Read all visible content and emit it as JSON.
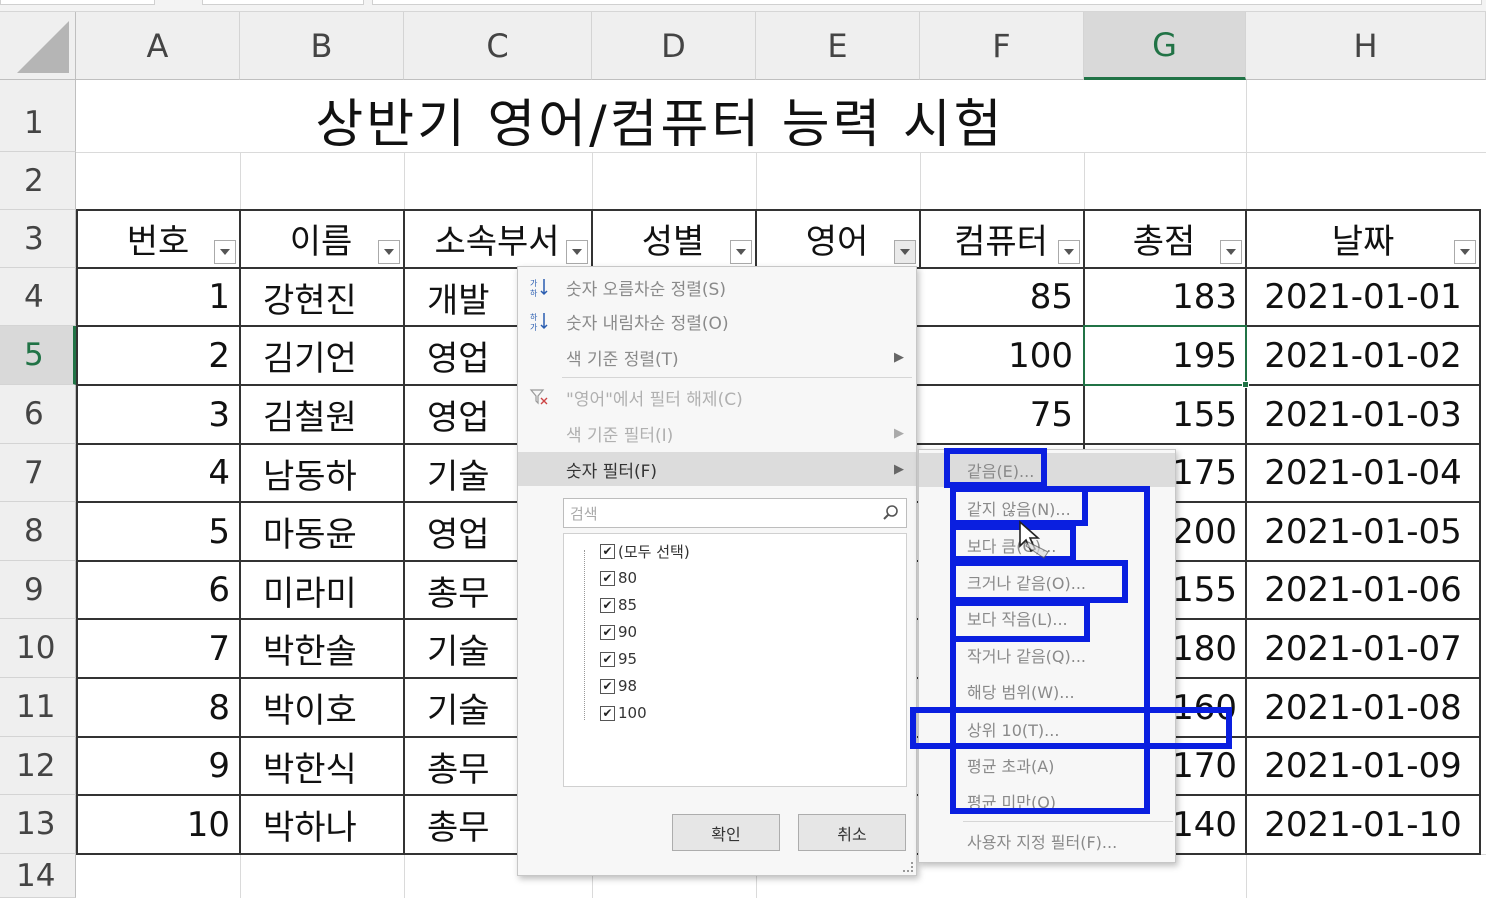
{
  "columns": [
    "A",
    "B",
    "C",
    "D",
    "E",
    "F",
    "G",
    "H"
  ],
  "row_numbers": [
    "1",
    "2",
    "3",
    "4",
    "5",
    "6",
    "7",
    "8",
    "9",
    "10",
    "11",
    "12",
    "13",
    "14"
  ],
  "active_column": "G",
  "active_row": "5",
  "title": "상반기 영어/컴퓨터 능력 시험",
  "table": {
    "headers": [
      "번호",
      "이름",
      "소속부서",
      "성별",
      "영어",
      "컴퓨터",
      "총점",
      "날짜"
    ],
    "rows": [
      {
        "no": "1",
        "name": "강현진",
        "dept": "개발",
        "computer": "85",
        "total": "183",
        "date": "2021-01-01"
      },
      {
        "no": "2",
        "name": "김기언",
        "dept": "영업",
        "computer": "100",
        "total": "195",
        "date": "2021-01-02"
      },
      {
        "no": "3",
        "name": "김철원",
        "dept": "영업",
        "computer": "75",
        "total": "155",
        "date": "2021-01-03"
      },
      {
        "no": "4",
        "name": "남동하",
        "dept": "기술",
        "computer": "",
        "total": "175",
        "date": "2021-01-04"
      },
      {
        "no": "5",
        "name": "마동윤",
        "dept": "영업",
        "computer": "",
        "total": "200",
        "date": "2021-01-05"
      },
      {
        "no": "6",
        "name": "미라미",
        "dept": "총무",
        "computer": "",
        "total": "155",
        "date": "2021-01-06"
      },
      {
        "no": "7",
        "name": "박한솔",
        "dept": "기술",
        "computer": "",
        "total": "180",
        "date": "2021-01-07"
      },
      {
        "no": "8",
        "name": "박이호",
        "dept": "기술",
        "computer": "",
        "total": "160",
        "date": "2021-01-08"
      },
      {
        "no": "9",
        "name": "박한식",
        "dept": "총무",
        "computer": "",
        "total": "170",
        "date": "2021-01-09"
      },
      {
        "no": "10",
        "name": "박하나",
        "dept": "총무",
        "computer": "",
        "total": "140",
        "date": "2021-01-10"
      }
    ]
  },
  "filter_menu": {
    "sort_asc": "숫자 오름차순 정렬(S)",
    "sort_desc": "숫자 내림차순 정렬(O)",
    "sort_color": "색 기준 정렬(T)",
    "clear_filter": "\"영어\"에서 필터 해제(C)",
    "filter_color": "색 기준 필터(I)",
    "number_filter": "숫자 필터(F)",
    "search_placeholder": "검색",
    "checklist": [
      "(모두 선택)",
      "80",
      "85",
      "90",
      "95",
      "98",
      "100"
    ],
    "ok": "확인",
    "cancel": "취소",
    "icons": {
      "sort_asc": "sort-ascending-icon",
      "sort_desc": "sort-descending-icon",
      "clear": "clear-filter-icon",
      "search": "search-icon"
    }
  },
  "number_filter_submenu": {
    "items": [
      "같음(E)...",
      "같지 않음(N)...",
      "보다 큼(G)...",
      "크거나 같음(O)...",
      "보다 작음(L)...",
      "작거나 같음(Q)...",
      "해당 범위(W)...",
      "상위 10(T)...",
      "평균 초과(A)",
      "평균 미만(O)"
    ],
    "custom": "사용자 지정 필터(F)..."
  },
  "colors": {
    "annotation": "#0a1fe0",
    "excel_green": "#217346"
  }
}
